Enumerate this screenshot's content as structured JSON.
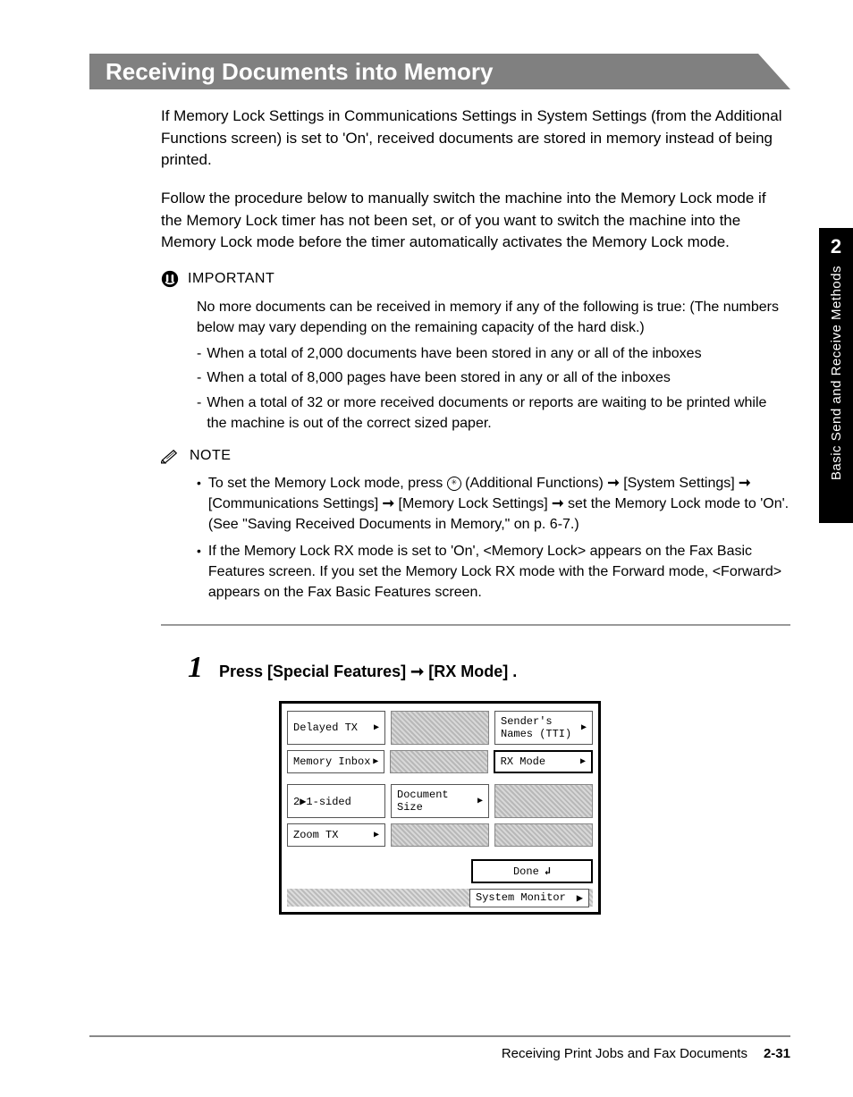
{
  "side_tab": {
    "chapter": "2",
    "label": "Basic Send and Receive Methods"
  },
  "title": "Receiving Documents into Memory",
  "para1": "If Memory Lock Settings in Communications Settings in System Settings (from the Additional Functions screen) is set to 'On', received documents are stored in memory instead of being printed.",
  "para2": "Follow the procedure below to manually switch the machine into the Memory Lock mode if the Memory Lock timer has not been set, or of you want to switch the machine into the Memory Lock mode before the timer automatically activates the Memory Lock mode.",
  "important": {
    "heading": "IMPORTANT",
    "lead": "No more documents can be received in memory if any of the following is true: (The numbers below may vary depending on the remaining capacity of the hard disk.)",
    "items": [
      "When a total of 2,000 documents have been stored in any or all of the inboxes",
      "When a total of 8,000 pages have been stored in any or all of the inboxes",
      "When a total of 32 or more received documents or reports are waiting to be printed while the machine is out of the correct sized paper."
    ]
  },
  "note": {
    "heading": "NOTE",
    "items": [
      {
        "pre": "To set the Memory Lock mode, press ",
        "af": " (Additional Functions) ",
        "seg1": "[System Settings] ",
        "seg2": "[Communications Settings] ",
        "seg3": "[Memory Lock Settings] ",
        "seg4": "set the Memory Lock mode to 'On'. (See \"Saving Received Documents in Memory,\" on p. 6-7.)"
      },
      {
        "text": "If the Memory Lock RX mode is set to 'On', <Memory Lock> appears on the Fax Basic Features screen. If you set the Memory Lock RX mode with the Forward mode, <Forward> appears on the Fax Basic Features screen."
      }
    ]
  },
  "step": {
    "num": "1",
    "pre": "Press [Special Features] ",
    "post": "[RX Mode] ."
  },
  "screen": {
    "delayed_tx": "Delayed TX",
    "senders": "Sender's\nNames (TTI)",
    "memory_inbox": "Memory Inbox",
    "rx_mode": "RX Mode",
    "two_one": "2▶1-sided",
    "doc_size": "Document\nSize",
    "zoom_tx": "Zoom TX",
    "done": "Done",
    "system_monitor": "System Monitor"
  },
  "footer": {
    "title": "Receiving Print Jobs and Fax Documents",
    "page": "2-31"
  },
  "glyphs": {
    "arrow": "➞",
    "tri": "▶",
    "enter": "↲",
    "dash": "-",
    "bullet": "•"
  }
}
